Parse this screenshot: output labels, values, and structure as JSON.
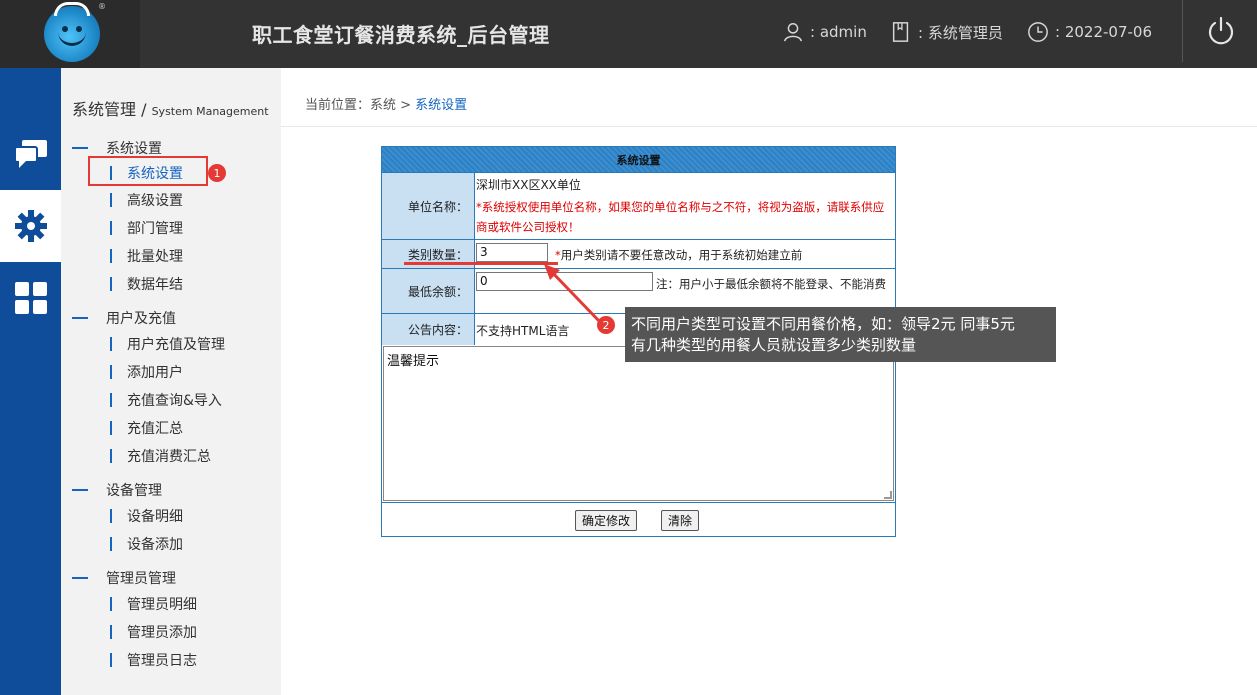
{
  "header": {
    "title": "职工食堂订餐消费系统_后台管理",
    "user": ": admin",
    "role": ": 系统管理员",
    "date": ": 2022-07-06",
    "logo_mark": "®"
  },
  "rail": {
    "icons": [
      "chat-icon",
      "gear-icon",
      "grid-icon"
    ],
    "active_index": 1
  },
  "submenu": {
    "title": "系统管理 / ",
    "title_en": "System Management",
    "groups": [
      {
        "label": "系统设置",
        "items": [
          "系统设置",
          "高级设置",
          "部门管理",
          "批量处理",
          "数据年结"
        ]
      },
      {
        "label": "用户及充值",
        "items": [
          "用户充值及管理",
          "添加用户",
          "充值查询&导入",
          "充值汇总",
          "充值消费汇总"
        ]
      },
      {
        "label": "设备管理",
        "items": [
          "设备明细",
          "设备添加"
        ]
      },
      {
        "label": "管理员管理",
        "items": [
          "管理员明细",
          "管理员添加",
          "管理员日志"
        ]
      }
    ],
    "badge1": "1"
  },
  "breadcrumb": {
    "prefix": "当前位置：系统 > ",
    "current": "系统设置"
  },
  "form": {
    "heading": "系统设置",
    "unit_label": "单位名称：",
    "unit_value": "深圳市XX区XX单位",
    "unit_note_star": "*",
    "unit_note": "系统授权使用单位名称，如果您的单位名称与之不符，将视为盗版，请联系供应商或软件公司授权！",
    "category_label": "类别数量：",
    "category_value": "3",
    "category_note_star": "*",
    "category_note": "用户类别请不要任意改动，用于系统初始建立前",
    "min_balance_label": "最低余额：",
    "min_balance_value": "0",
    "min_balance_note": "注：用户小于最低余额将不能登录、不能消费",
    "notice_label": "公告内容：",
    "notice_note": "不支持HTML语言",
    "notice_text": "温馨提示",
    "confirm_label": "确定修改",
    "clear_label": "清除"
  },
  "annotation": {
    "badge2": "2",
    "tooltip_line1": "不同用户类型可设置不同用餐价格，如：领导2元  同事5元",
    "tooltip_line2": "有几种类型的用餐人员就设置多少类别数量"
  },
  "colors": {
    "header_bg": "#333333",
    "rail_bg": "#0f4c9a",
    "accent": "#1565c0",
    "annotation_red": "#e53935"
  }
}
